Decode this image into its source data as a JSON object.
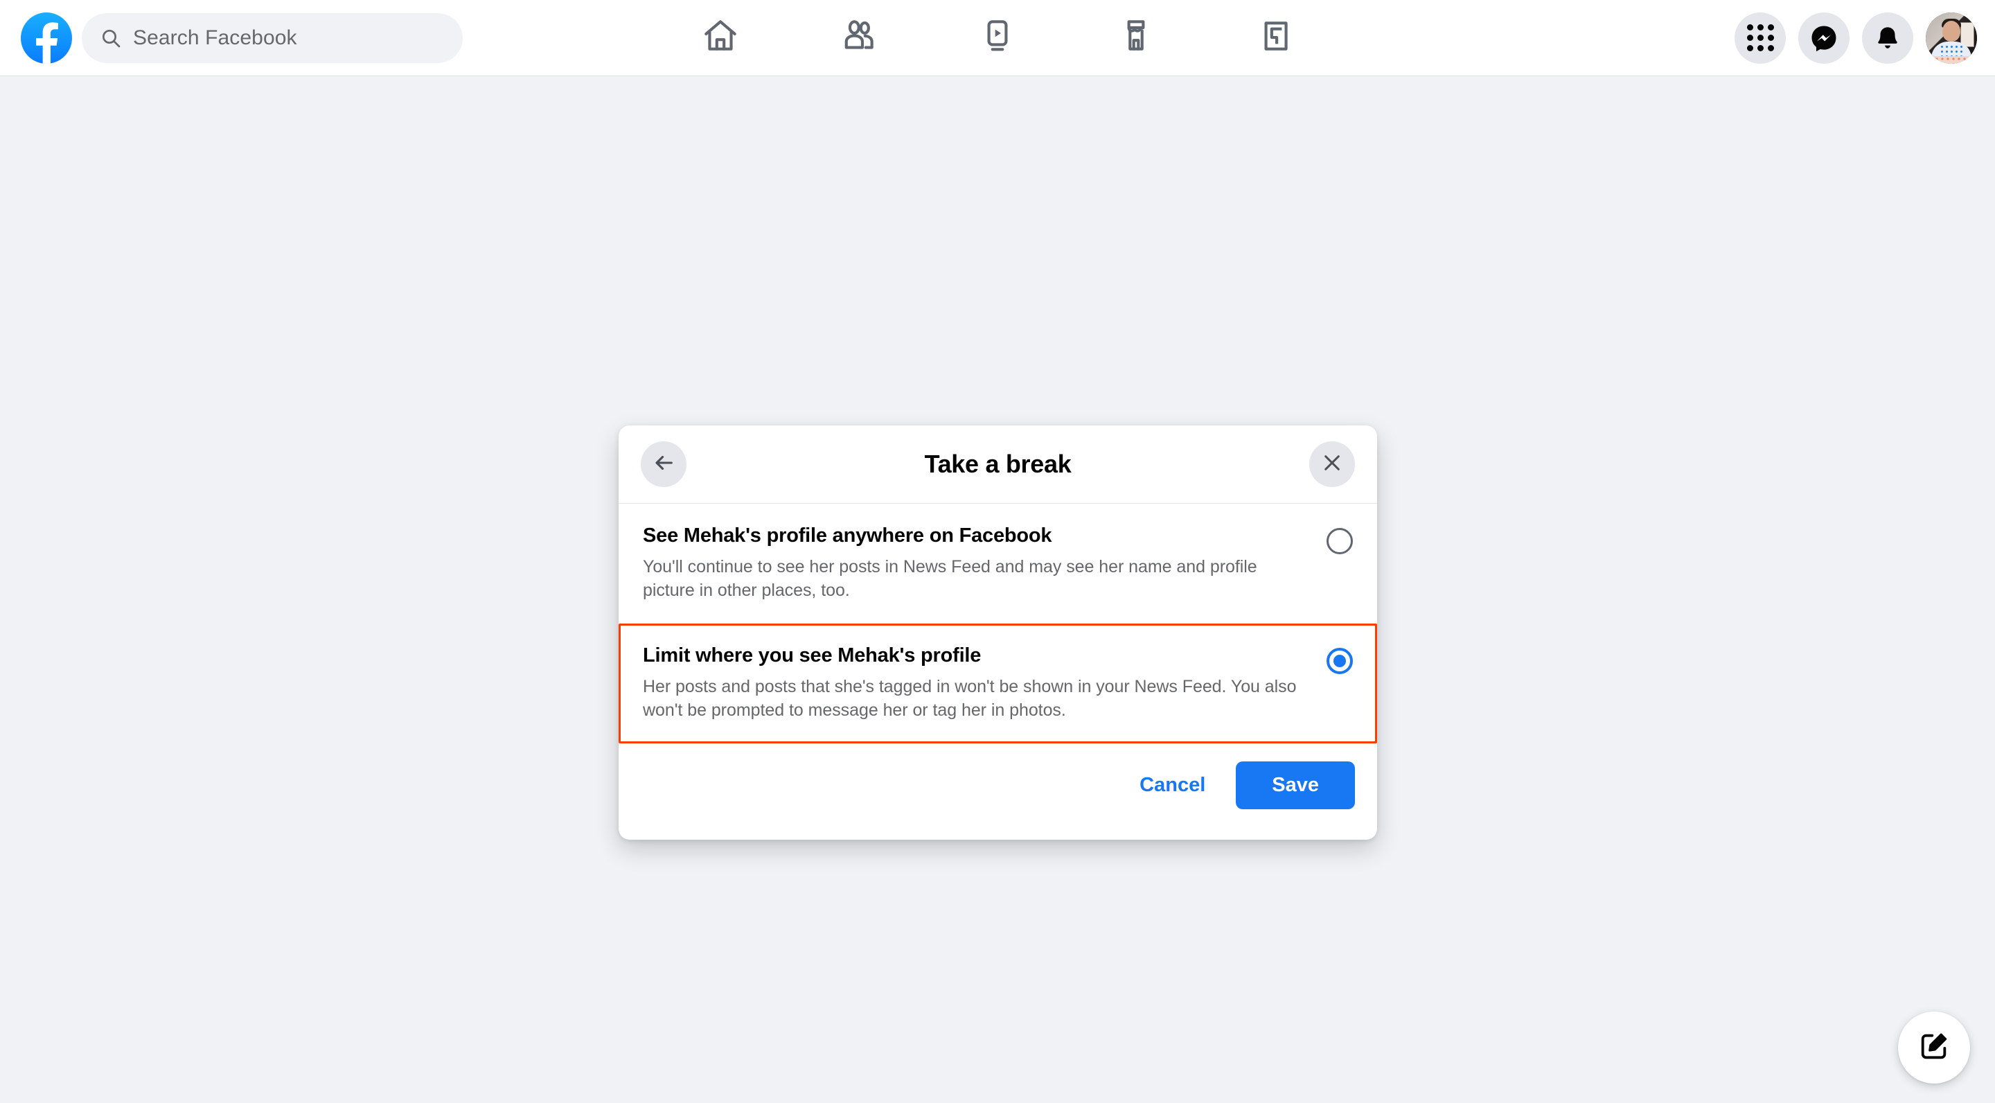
{
  "header": {
    "logo_icon": "facebook-logo-icon",
    "search": {
      "icon": "search-icon",
      "placeholder": "Search Facebook",
      "value": ""
    },
    "nav_tabs": [
      {
        "name": "home",
        "icon": "home-icon",
        "label": "Home"
      },
      {
        "name": "friends",
        "icon": "friends-icon",
        "label": "Friends"
      },
      {
        "name": "watch",
        "icon": "watch-icon",
        "label": "Watch"
      },
      {
        "name": "marketplace",
        "icon": "marketplace-icon",
        "label": "Marketplace"
      },
      {
        "name": "gaming",
        "icon": "gaming-icon",
        "label": "Gaming"
      }
    ],
    "actions": [
      {
        "name": "menu",
        "icon": "grid-menu-icon",
        "label": "Menu"
      },
      {
        "name": "messenger",
        "icon": "messenger-icon",
        "label": "Messenger"
      },
      {
        "name": "notifications",
        "icon": "bell-icon",
        "label": "Notifications"
      }
    ],
    "account": {
      "name": "avatar",
      "label": "Account"
    }
  },
  "modal": {
    "title": "Take a break",
    "back_icon": "arrow-left-icon",
    "close_icon": "close-icon",
    "options": [
      {
        "title": "See Mehak's profile anywhere on Facebook",
        "description": "You'll continue to see her posts in News Feed and may see her name and profile picture in other places, too.",
        "selected": false,
        "highlighted": false
      },
      {
        "title": "Limit where you see Mehak's profile",
        "description": "Her posts and posts that she's tagged in won't be shown in your News Feed. You also won't be prompted to message her or tag her in photos.",
        "selected": true,
        "highlighted": true
      }
    ],
    "footer": {
      "cancel_label": "Cancel",
      "save_label": "Save"
    }
  },
  "fab": {
    "icon": "compose-icon",
    "label": "Create"
  },
  "colors": {
    "page_background": "#f0f2f5",
    "surface": "#ffffff",
    "accent_blue": "#1877f2",
    "highlight_red": "#fa3e00",
    "text_primary": "#050505",
    "text_secondary": "#65676b"
  }
}
